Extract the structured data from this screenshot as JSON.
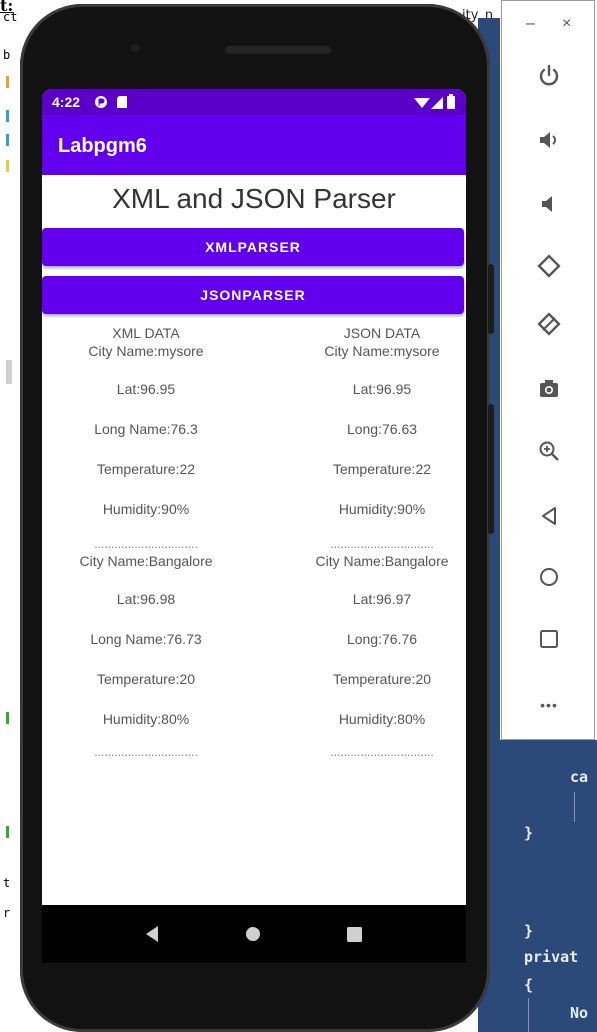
{
  "background": {
    "top_fragment": "t:",
    "left_fragments": [
      "ct",
      "b",
      "!",
      "!",
      "!",
      "!",
      "t",
      "r"
    ],
    "tab_fragment": "ity_n",
    "code_lines": [
      "ca",
      "}",
      "}",
      "privat",
      "{",
      "No"
    ]
  },
  "emulator_toolbar": {
    "minimize": "–",
    "close": "×",
    "icons": [
      "power-icon",
      "volume-up-icon",
      "volume-down-icon",
      "rotate-left-icon",
      "rotate-right-icon",
      "camera-icon",
      "zoom-icon",
      "back-icon",
      "home-icon",
      "overview-icon",
      "more-icon"
    ],
    "more_label": "•••"
  },
  "phone": {
    "status_time": "4:22",
    "app_title": "Labpgm6",
    "heading": "XML and JSON Parser",
    "xml_button": "XMLPARSER",
    "json_button": "JSONPARSER",
    "xml": {
      "header": "XML DATA",
      "city1": "City Name:mysore",
      "lat1": "Lat:96.95",
      "long1": "Long Name:76.3",
      "temp1": "Temperature:22",
      "hum1": "Humidity:90%",
      "sep1": "...............................",
      "city2": "City Name:Bangalore",
      "lat2": "Lat:96.98",
      "long2": "Long Name:76.73",
      "temp2": "Temperature:20",
      "hum2": "Humidity:80%",
      "sep2": "..............................."
    },
    "json": {
      "header": "JSON DATA",
      "city1": "City Name:mysore",
      "lat1": "Lat:96.95",
      "long1": "Long:76.63",
      "temp1": "Temperature:22",
      "hum1": "Humidity:90%",
      "sep1": "...............................",
      "city2": "City Name:Bangalore",
      "lat2": "Lat:96.97",
      "long2": "Long:76.76",
      "temp2": "Temperature:20",
      "hum2": "Humidity:80%",
      "sep2": "..............................."
    }
  },
  "colors": {
    "primary": "#6200ee",
    "status_bar": "#5a00c8",
    "toolbar_icon": "#555555",
    "code_bg": "#2b4a7a"
  }
}
